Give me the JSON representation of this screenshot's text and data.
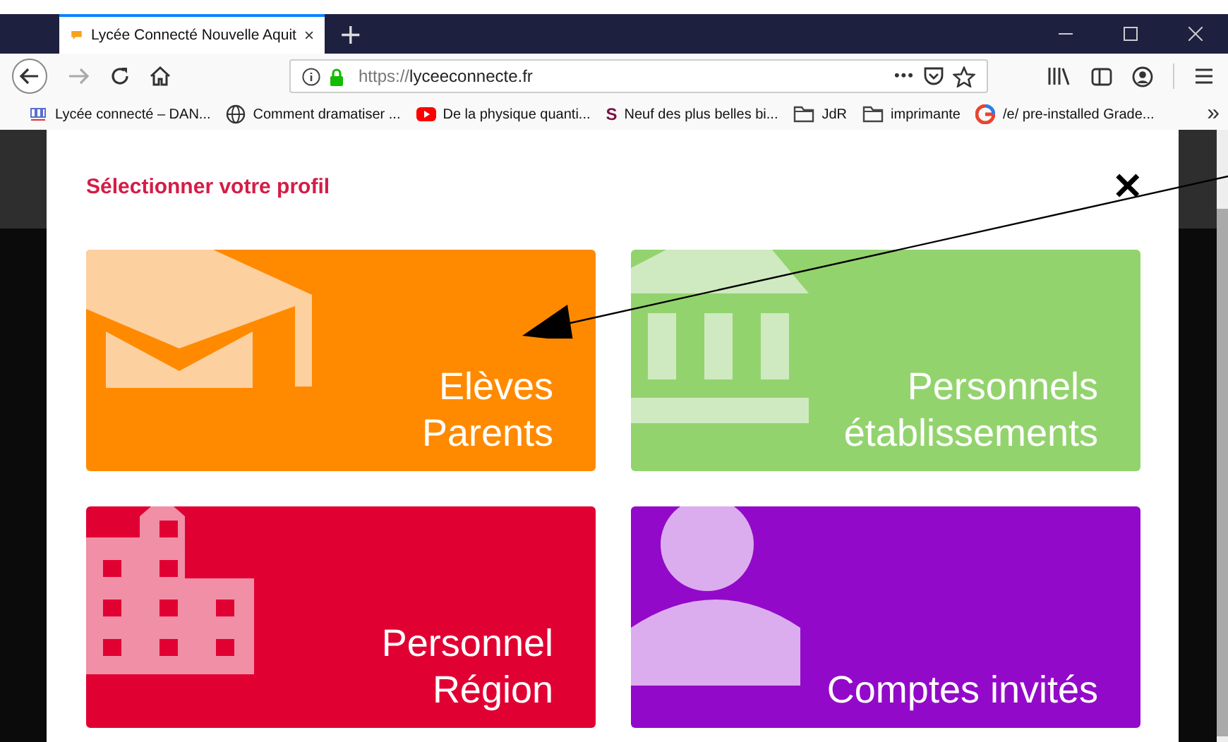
{
  "tab": {
    "title": "Lycée Connecté Nouvelle Aquit",
    "selected": true
  },
  "new_tab": "+",
  "address_bar": {
    "url_scheme": "https://",
    "url_host": "lyceeconnecte.fr",
    "more": "•••"
  },
  "bookmarks": [
    {
      "kind": "logo",
      "label": "Lycée connecté – DAN..."
    },
    {
      "kind": "globe",
      "label": "Comment dramatiser ..."
    },
    {
      "kind": "video",
      "label": "De la physique quanti..."
    },
    {
      "kind": "letter",
      "icon_text": "S",
      "label": "Neuf des plus belles bi..."
    },
    {
      "kind": "folder",
      "label": "JdR"
    },
    {
      "kind": "folder",
      "label": "imprimante"
    },
    {
      "kind": "ring",
      "label": "/e/ pre-installed Grade..."
    }
  ],
  "bookmarks_overflow": "»",
  "modal": {
    "title": "Sélectionner votre profil",
    "close": "✕",
    "tiles": [
      {
        "kind": "cap",
        "color": "#ff8a00",
        "lines": [
          "Elèves",
          "Parents"
        ]
      },
      {
        "kind": "columns",
        "color": "#93d36e",
        "lines": [
          "Personnels",
          "établissements"
        ]
      },
      {
        "kind": "office",
        "color": "#e10032",
        "lines": [
          "Personnel",
          "Région"
        ]
      },
      {
        "kind": "person",
        "color": "#9309c9",
        "lines": [
          "Comptes invités"
        ]
      }
    ]
  }
}
